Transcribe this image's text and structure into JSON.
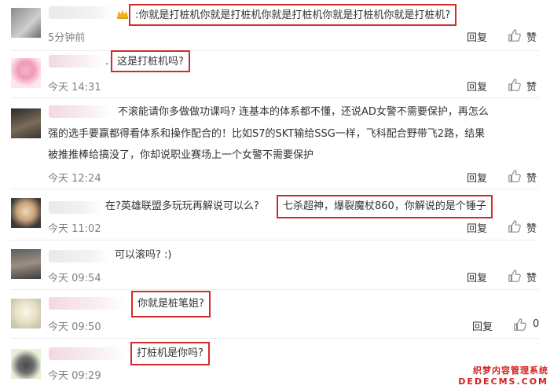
{
  "comments": [
    {
      "text_prefix": "",
      "highlight": ":你就是打桩机你就是打桩机你就是打桩机你就是打桩机你就是打桩机?",
      "time": "5分钟前",
      "reply": "回复",
      "like": "赞"
    },
    {
      "text_prefix": ".",
      "highlight": "这是打桩机吗?",
      "time": "今天 14:31",
      "reply": "回复",
      "like": "赞"
    },
    {
      "lines": [
        "不滚能请你多做做功课吗? 连基本的体系都不懂，还说AD女警不需要保护，再怎么",
        "强的选手要赢都得看体系和操作配合的！比如S7的SKT输给SSG一样，飞科配合野带飞2路，结果",
        "被推推棒给搞没了，你却说职业赛场上一个女警不需要保护"
      ],
      "time": "今天 12:24",
      "reply": "回复",
      "like": "赞"
    },
    {
      "text_prefix": "在?英雄联盟多玩玩再解说可以么?",
      "highlight": "七杀超神，爆裂魔杖860，你解说的是个锤子",
      "time": "今天 11:02",
      "reply": "回复",
      "like": "赞"
    },
    {
      "text_prefix": "可以滚吗? :)",
      "time": "今天 09:54",
      "reply": "回复",
      "like": "赞"
    },
    {
      "highlight": "你就是桩笔姐?",
      "time": "今天 09:50",
      "reply": "回复",
      "like": ""
    },
    {
      "highlight": "打桩机是你吗?",
      "time": "今天 09:29",
      "reply": "",
      "like": ""
    }
  ],
  "watermark": {
    "line1": "织梦内容管理系统",
    "line2": "DEDECMS.COM"
  }
}
